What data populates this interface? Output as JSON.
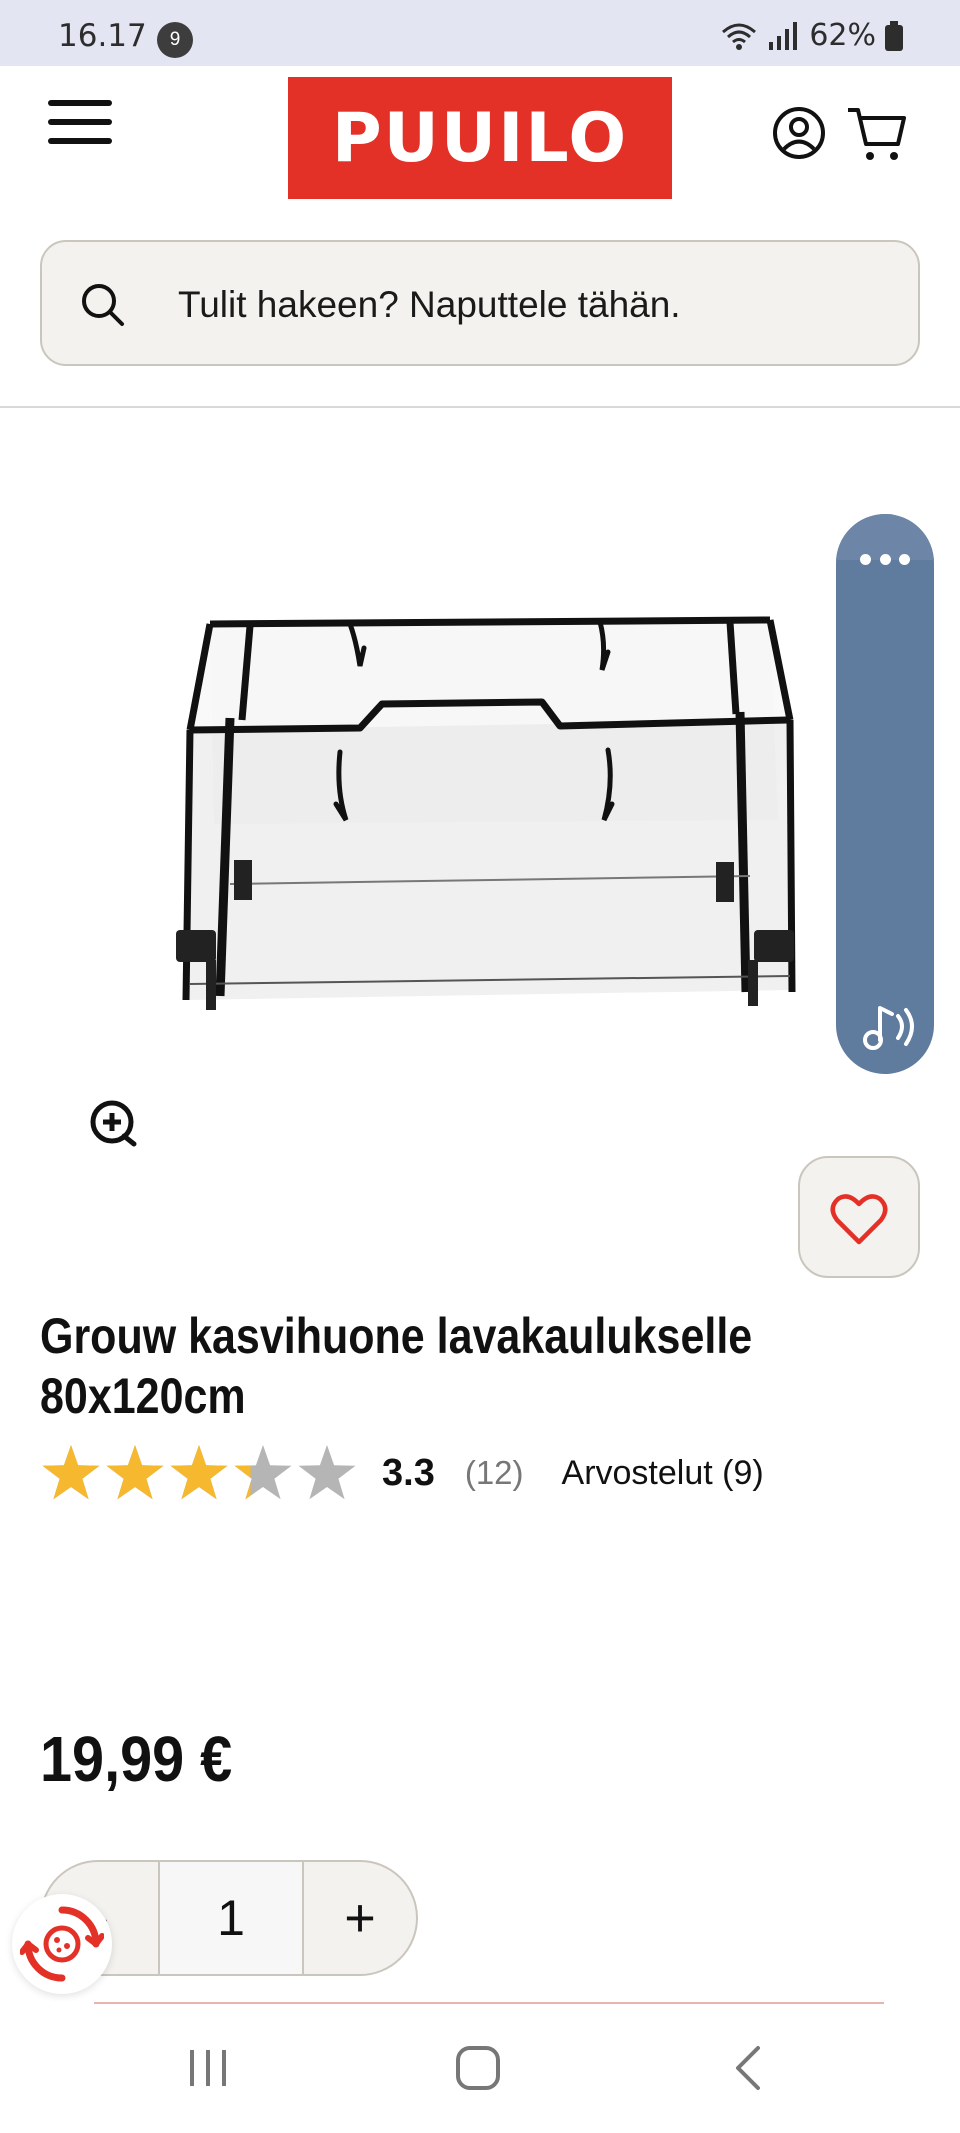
{
  "status_bar": {
    "time": "16.17",
    "notification_count": "9",
    "battery": "62%"
  },
  "header": {
    "logo_text": "PUUILO",
    "brand_color": "#e33127"
  },
  "search": {
    "placeholder": "Tulit hakeen? Naputtele tähän."
  },
  "product": {
    "title": "Grouw kasvihuone lavakaulukselle 80x120cm",
    "rating_value": "3.3",
    "rating_count": "(12)",
    "rating_stars_of_5": 3.3,
    "reviews_label": "Arvostelut (9)",
    "price": "19,99 €"
  },
  "quantity": {
    "minus_label": "-",
    "value": "1",
    "plus_label": "+"
  },
  "icons": {
    "menu": "hamburger-menu-icon",
    "account": "account-icon",
    "cart": "cart-icon",
    "search": "search-icon",
    "zoom": "zoom-in-icon",
    "wishlist": "heart-icon",
    "audio": "audio-readout-icon",
    "cookie": "cookie-consent-icon"
  },
  "colors": {
    "star_filled": "#f5b82e",
    "star_empty": "#b5b5b5",
    "heart": "#e33127",
    "side_widget": "#5f7b9e"
  }
}
